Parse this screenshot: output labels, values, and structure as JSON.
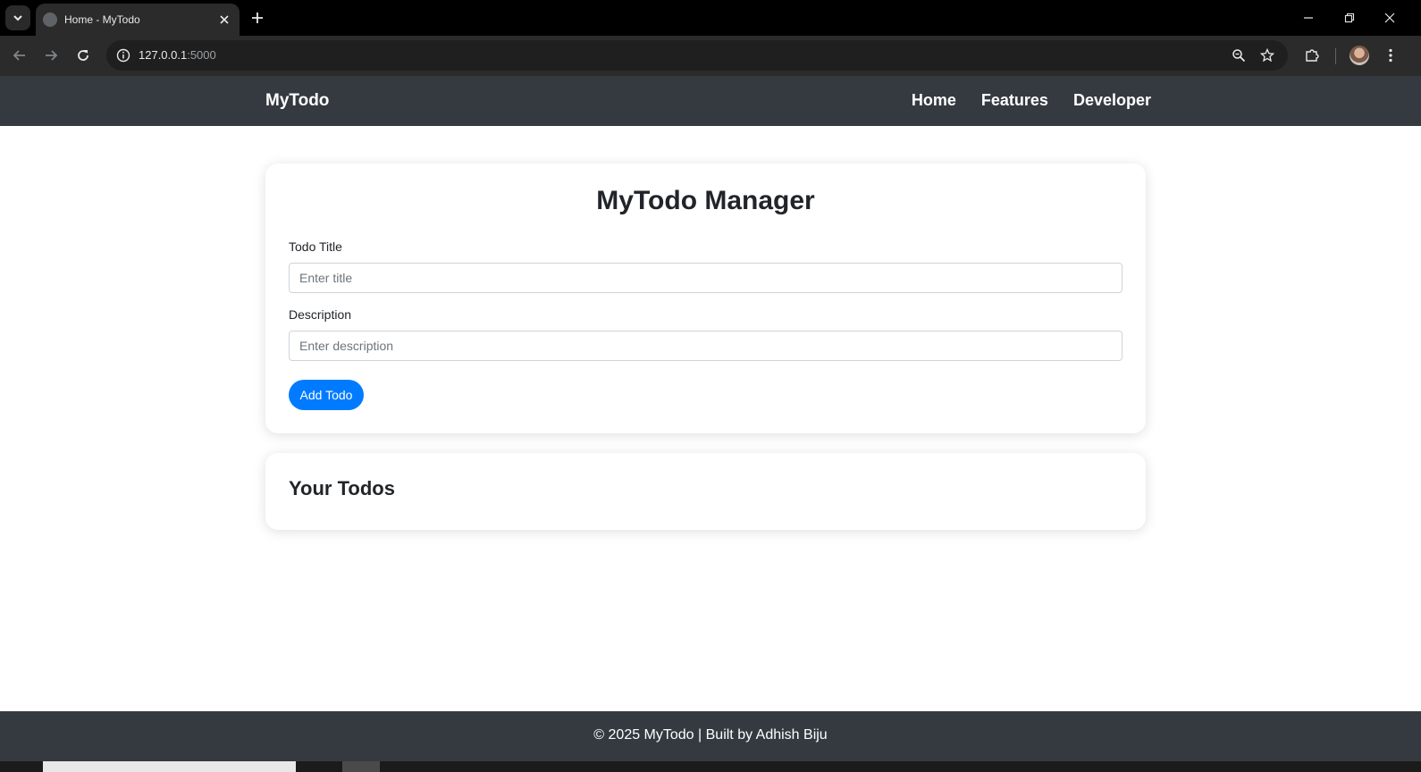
{
  "browser": {
    "tab_title": "Home - MyTodo",
    "url_host": "127.0.0.1",
    "url_port": ":5000"
  },
  "navbar": {
    "brand": "MyTodo",
    "links": [
      "Home",
      "Features",
      "Developer"
    ]
  },
  "form": {
    "title": "MyTodo Manager",
    "title_label": "Todo Title",
    "title_placeholder": "Enter title",
    "description_label": "Description",
    "description_placeholder": "Enter description",
    "submit_label": "Add Todo"
  },
  "todos": {
    "heading": "Your Todos",
    "items": []
  },
  "footer": {
    "text": "© 2025 MyTodo | Built by Adhish Biju"
  },
  "colors": {
    "navbar_bg": "#343a40",
    "primary": "#007bff"
  }
}
